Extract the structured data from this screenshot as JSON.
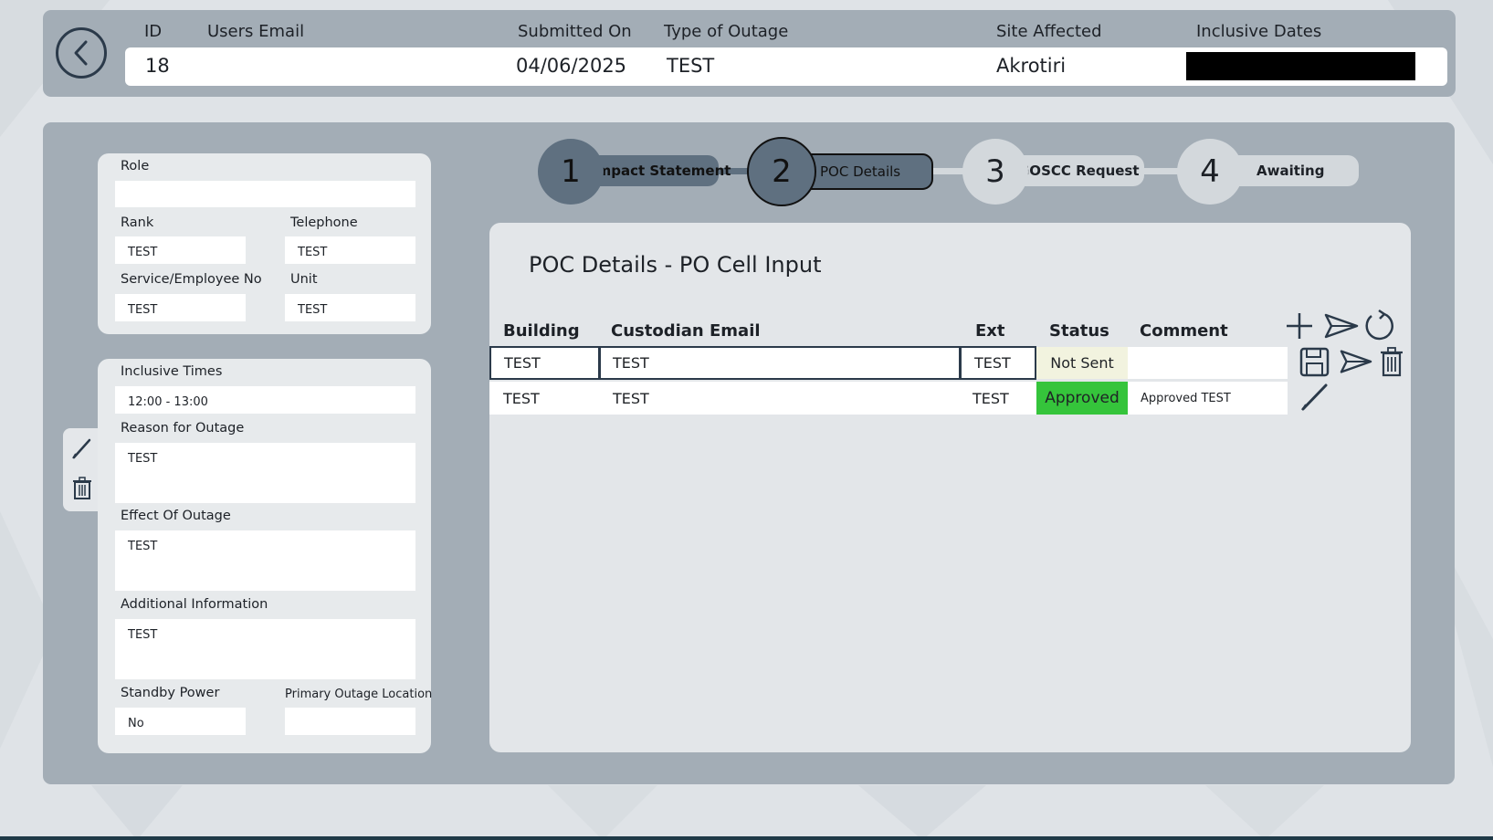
{
  "header": {
    "columns": {
      "id": "ID",
      "email": "Users Email",
      "submitted": "Submitted On",
      "outage_type": "Type of Outage",
      "site": "Site Affected",
      "dates": "Inclusive Dates"
    },
    "values": {
      "id": "18",
      "email": "",
      "submitted": "04/06/2025",
      "outage_type": "TEST",
      "site": "Akrotiri"
    }
  },
  "user_card": {
    "role_label": "Role",
    "role_value": "",
    "rank_label": "Rank",
    "rank_value": "TEST",
    "telephone_label": "Telephone",
    "telephone_value": "TEST",
    "service_label": "Service/Employee No",
    "service_value": "TEST",
    "unit_label": "Unit",
    "unit_value": "TEST"
  },
  "outage_card": {
    "times_label": "Inclusive Times",
    "times_value": "12:00 - 13:00",
    "reason_label": "Reason for Outage",
    "reason_value": "TEST",
    "effect_label": "Effect Of Outage",
    "effect_value": "TEST",
    "additional_label": "Additional Information",
    "additional_value": "TEST",
    "standby_label": "Standby Power",
    "standby_value": "No",
    "primary_label": "Primary Outage Location",
    "primary_value": ""
  },
  "steps": [
    {
      "number": "1",
      "label": "Impact Statement"
    },
    {
      "number": "2",
      "label": "POC Details"
    },
    {
      "number": "3",
      "label": "GOSCC Request"
    },
    {
      "number": "4",
      "label": "Awaiting"
    }
  ],
  "poc": {
    "title": "POC Details - PO Cell Input",
    "columns": {
      "building": "Building",
      "email": "Custodian Email",
      "ext": "Ext",
      "status": "Status",
      "comment": "Comment"
    },
    "rows": [
      {
        "building": "TEST",
        "email": "TEST",
        "ext": "TEST",
        "status": "Not Sent",
        "comment": ""
      },
      {
        "building": "TEST",
        "email": "TEST",
        "ext": "TEST",
        "status": "Approved",
        "comment": "Approved TEST"
      }
    ]
  },
  "colors": {
    "panel": "#a3adb6",
    "active_step": "#5f7080",
    "status_not_sent": "#f2f3df",
    "status_approved": "#35c43b",
    "icon": "#2b3a4a"
  },
  "icons": {
    "back": "chevron-left-icon",
    "add": "plus-icon",
    "send": "send-icon",
    "refresh": "refresh-icon",
    "save": "save-icon",
    "delete": "trash-icon",
    "edit": "pencil-icon"
  }
}
